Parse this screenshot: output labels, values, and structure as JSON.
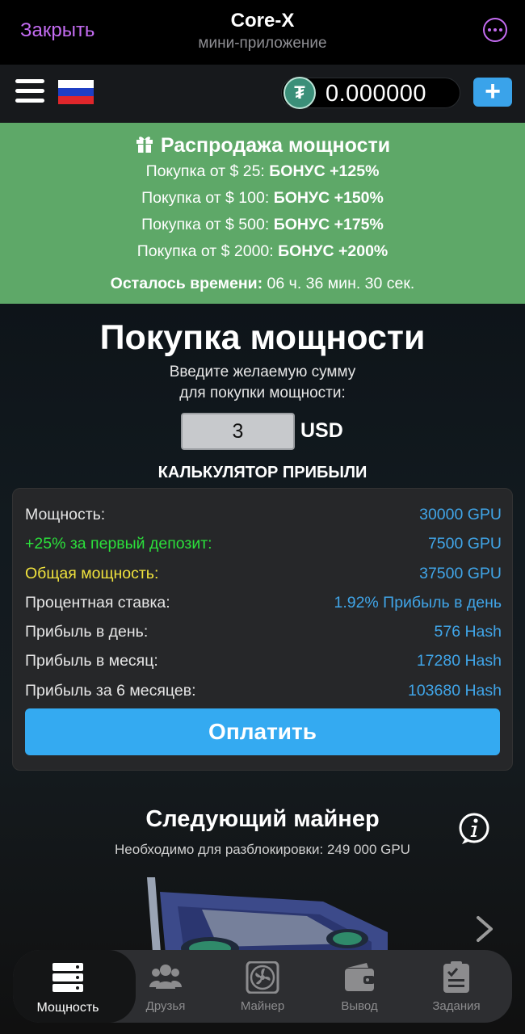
{
  "telegram": {
    "close_label": "Закрыть",
    "title": "Core-X",
    "subtitle": "мини-приложение",
    "menu_icon": "more-icon"
  },
  "appbar": {
    "menu_icon": "hamburger-icon",
    "language_flag": "russia-flag-icon",
    "balance_icon": "tether-icon",
    "balance_value": "0.000000",
    "add_button_label": "+"
  },
  "promo": {
    "title": "Распродажа мощности",
    "icon": "gift-icon",
    "lines": [
      {
        "prefix": "Покупка от $ 25: ",
        "bonus": "БОНУС +125%"
      },
      {
        "prefix": "Покупка от $ 100: ",
        "bonus": "БОНУС +150%"
      },
      {
        "prefix": "Покупка от $ 500: ",
        "bonus": "БОНУС +175%"
      },
      {
        "prefix": "Покупка от $ 2000: ",
        "bonus": "БОНУС +200%"
      }
    ],
    "timer_label": "Осталось времени:",
    "timer_value": " 06 ч. 36 мин. 30 сек."
  },
  "purchase": {
    "title": "Покупка мощности",
    "subtitle_line1": "Введите желаемую сумму",
    "subtitle_line2": "для покупки мощности:",
    "amount_value": "3",
    "currency": "USD"
  },
  "calculator": {
    "title": "КАЛЬКУЛЯТОР ПРИБЫЛИ",
    "rows": [
      {
        "label": "Мощность:",
        "value": "30000 GPU",
        "accent": "normal"
      },
      {
        "label": "+25% за первый депозит:",
        "value": "7500 GPU",
        "accent": "green"
      },
      {
        "label": "Общая мощность:",
        "value": "37500 GPU",
        "accent": "yellow"
      },
      {
        "label": "Процентная ставка:",
        "value": "1.92% Прибыль в день",
        "accent": "normal"
      },
      {
        "label": "Прибыль в день:",
        "value": "576 Hash",
        "accent": "normal"
      },
      {
        "label": "Прибыль в месяц:",
        "value": "17280 Hash",
        "accent": "normal"
      },
      {
        "label": "Прибыль за 6 месяцев:",
        "value": "103680 Hash",
        "accent": "normal"
      }
    ],
    "pay_label": "Оплатить"
  },
  "next_miner": {
    "title": "Следующий майнер",
    "subtitle": "Необходимо для разблокировки: 249 000 GPU",
    "info_icon": "info-icon",
    "image": "gpu-card-image",
    "next_icon": "chevron-right-icon"
  },
  "nav": {
    "items": [
      {
        "label": "Мощность",
        "icon": "server-icon",
        "active": true
      },
      {
        "label": "Друзья",
        "icon": "users-icon",
        "active": false
      },
      {
        "label": "Майнер",
        "icon": "fan-icon",
        "active": false
      },
      {
        "label": "Вывод",
        "icon": "wallet-icon",
        "active": false
      },
      {
        "label": "Задания",
        "icon": "tasks-icon",
        "active": false
      }
    ]
  },
  "colors": {
    "telegram_accent": "#c46cf2",
    "promo_bg": "#5ea868",
    "value_blue": "#40a5e8",
    "pay_button": "#34aaf1",
    "green": "#2be03b",
    "yellow": "#f0e23d"
  }
}
